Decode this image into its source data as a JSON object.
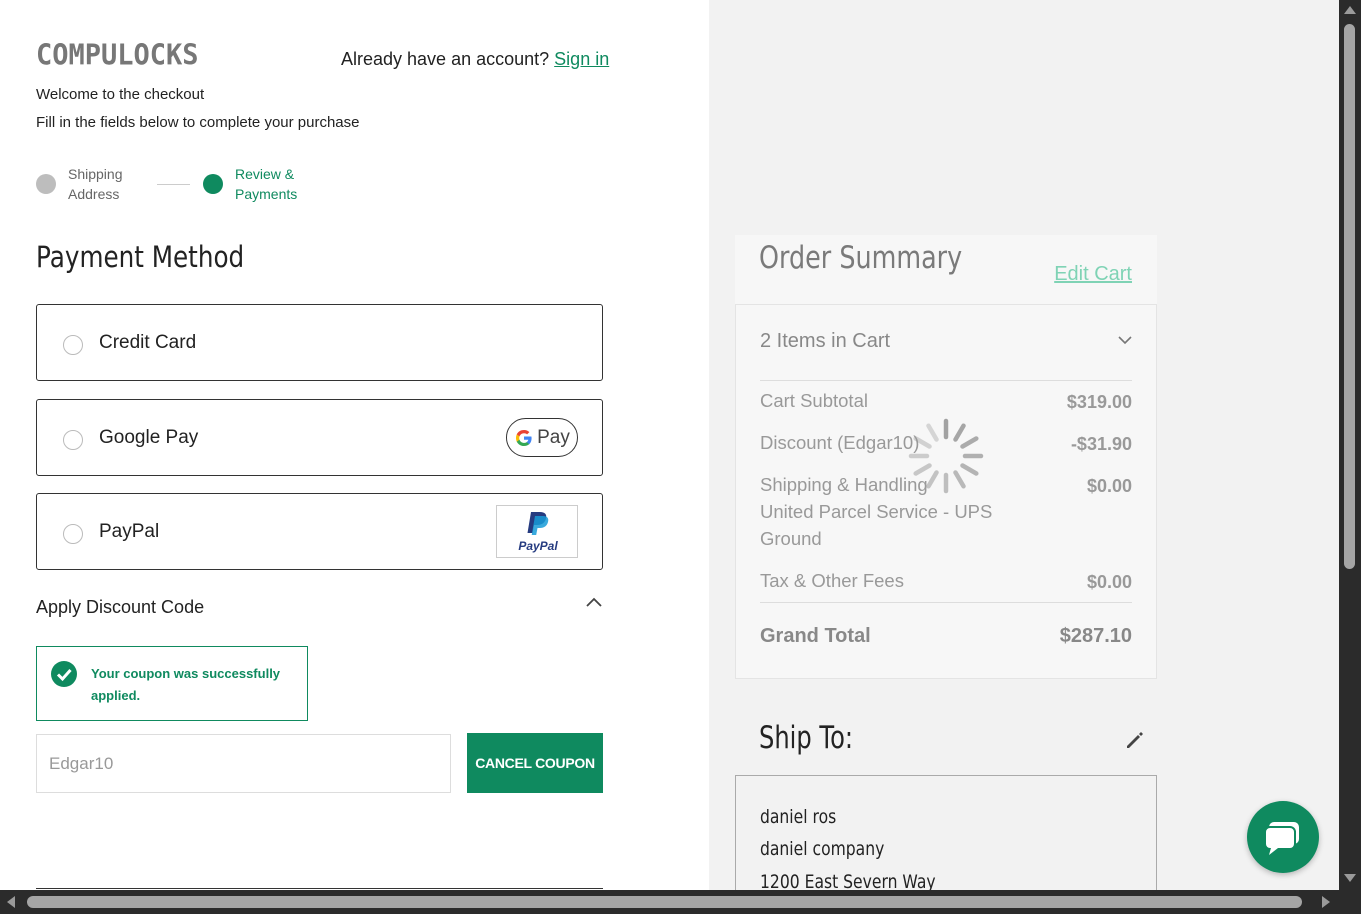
{
  "brand": {
    "logo_text": "COMPULOCKS",
    "accent": "#0f8a5f",
    "accent_light": "#7fd3b5"
  },
  "header": {
    "account_prompt": "Already have an account?",
    "sign_in": "Sign in",
    "welcome": "Welcome to the checkout",
    "instructions": "Fill in the fields below to complete your purchase"
  },
  "steps": [
    {
      "label_line1": "Shipping",
      "label_line2": "Address",
      "state": "completed"
    },
    {
      "label_line1": "Review &",
      "label_line2": "Payments",
      "state": "active"
    }
  ],
  "payment": {
    "title": "Payment Method",
    "options": [
      {
        "label": "Credit Card",
        "icon": null
      },
      {
        "label": "Google Pay",
        "icon": "google-pay-icon",
        "badge_text": "Pay"
      },
      {
        "label": "PayPal",
        "icon": "paypal-icon",
        "badge_text": "PayPal"
      }
    ]
  },
  "discount": {
    "title": "Apply Discount Code",
    "success_message": "Your coupon was successfully applied.",
    "code_value": "Edgar10",
    "cancel_label": "CANCEL COUPON"
  },
  "order_summary": {
    "title": "Order Summary",
    "edit_cart": "Edit Cart",
    "items_in_cart": "2 Items in Cart",
    "rows": [
      {
        "label": "Cart Subtotal",
        "value": "$319.00"
      },
      {
        "label": "Discount (Edgar10)",
        "value": "-$31.90"
      },
      {
        "label": "Shipping & Handling",
        "sublabel": "United Parcel Service - UPS Ground",
        "value": "$0.00"
      },
      {
        "label": "Tax & Other Fees",
        "value": "$0.00"
      }
    ],
    "grand_total_label": "Grand Total",
    "grand_total_value": "$287.10"
  },
  "ship_to": {
    "title": "Ship To:",
    "lines": [
      "daniel ros",
      "daniel company",
      "1200 East Severn Way"
    ]
  }
}
